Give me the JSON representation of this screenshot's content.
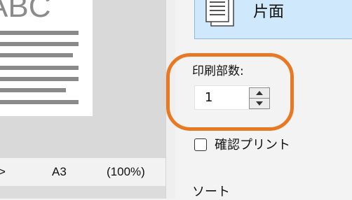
{
  "preview": {
    "document_heading": "ABC"
  },
  "status_bar": {
    "nav_arrow": ">",
    "paper_size": "A3",
    "zoom": "(100%)"
  },
  "side_panel": {
    "duplex_option_label": "片面",
    "copies_label": "印刷部数:",
    "copies_value": "1",
    "confirm_print_label": "確認プリント",
    "confirm_print_checked": false,
    "next_section_label_partial": "ソート"
  },
  "colors": {
    "highlight_ring": "#e97822",
    "selected_card_bg": "#cfe8fb",
    "selected_card_border": "#8cb7df"
  },
  "icons": {
    "duplex_option_icon": "single-sided-document-icon",
    "spin_up_icon": "triangle-up-icon",
    "spin_down_icon": "triangle-down-icon"
  }
}
